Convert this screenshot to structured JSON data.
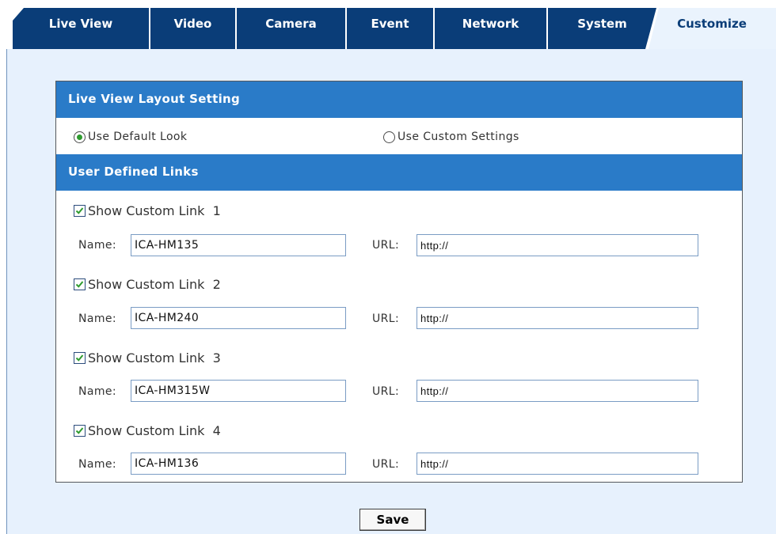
{
  "tabs": [
    {
      "label": "Live View",
      "active": false
    },
    {
      "label": "Video",
      "active": false
    },
    {
      "label": "Camera",
      "active": false
    },
    {
      "label": "Event",
      "active": false
    },
    {
      "label": "Network",
      "active": false
    },
    {
      "label": "System",
      "active": false
    },
    {
      "label": "Customize",
      "active": true
    }
  ],
  "layout_section": {
    "title": "Live View Layout Setting",
    "options": [
      {
        "label": "Use Default Look",
        "selected": true
      },
      {
        "label": "Use Custom Settings",
        "selected": false
      }
    ]
  },
  "links_section": {
    "title": "User Defined Links",
    "name_label": "Name:",
    "url_label": "URL:",
    "links": [
      {
        "show_label": "Show Custom Link  1",
        "checked": true,
        "name": "ICA-HM135",
        "url": "http://"
      },
      {
        "show_label": "Show Custom Link  2",
        "checked": true,
        "name": "ICA-HM240",
        "url": "http://"
      },
      {
        "show_label": "Show Custom Link  3",
        "checked": true,
        "name": "ICA-HM315W",
        "url": "http://"
      },
      {
        "show_label": "Show Custom Link  4",
        "checked": true,
        "name": "ICA-HM136",
        "url": "http://"
      }
    ]
  },
  "save_label": "Save",
  "colors": {
    "tab_dark": "#0a3d78",
    "tab_active_bg": "#eaf3fd",
    "section_header": "#2a7bc8",
    "page_bg": "#e7f1fd",
    "check_green": "#2e9b2e"
  },
  "icons": {
    "radio": "radio-icon",
    "checkbox": "checkmark-icon"
  }
}
